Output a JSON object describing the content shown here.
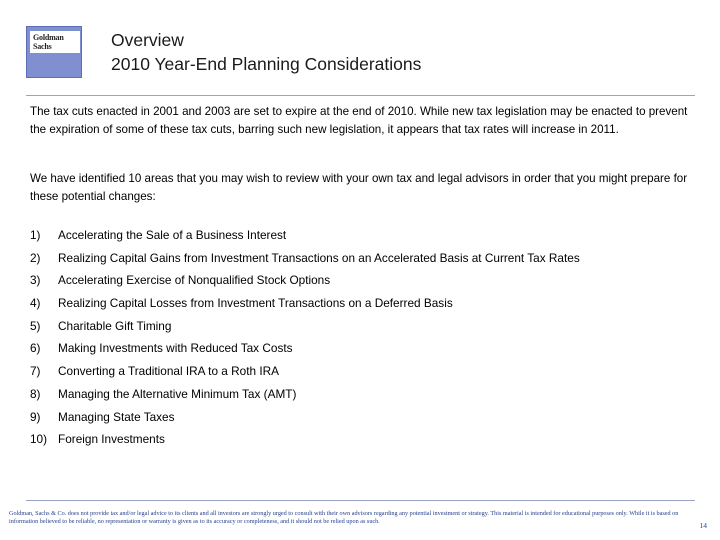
{
  "header": {
    "logo": {
      "line1": "Goldman",
      "line2": "Sachs"
    },
    "title_line1": "Overview",
    "title_line2": "2010 Year-End Planning Considerations"
  },
  "body": {
    "paragraph_1": "The tax cuts enacted in 2001 and 2003 are set to expire at the end of 2010.  While new tax legislation may be enacted to prevent the expiration of some of these tax cuts, barring such new legislation, it appears that tax rates will increase in 2011.",
    "paragraph_2": "We have identified 10 areas that you may wish to review with your own tax and legal advisors in order that you might prepare for these potential changes:",
    "items": [
      {
        "num": "1)",
        "text": "Accelerating the Sale of a Business Interest"
      },
      {
        "num": "2)",
        "text": "Realizing Capital Gains from Investment Transactions on an Accelerated Basis at Current Tax Rates"
      },
      {
        "num": "3)",
        "text": "Accelerating Exercise of Nonqualified Stock Options"
      },
      {
        "num": "4)",
        "text": "Realizing Capital Losses from Investment Transactions on a Deferred Basis"
      },
      {
        "num": "5)",
        "text": "Charitable Gift Timing"
      },
      {
        "num": "6)",
        "text": "Making Investments with Reduced Tax Costs"
      },
      {
        "num": "7)",
        "text": "Converting a Traditional IRA to a Roth IRA"
      },
      {
        "num": "8)",
        "text": "Managing the Alternative Minimum Tax (AMT)"
      },
      {
        "num": "9)",
        "text": "Managing State Taxes"
      },
      {
        "num": "10)",
        "text": "Foreign Investments"
      }
    ]
  },
  "footer": {
    "disclaimer": "Goldman, Sachs & Co. does not provide tax and/or legal advice to its clients and all investors are strongly urged to consult with their own advisors regarding any potential investment or strategy.  This material is intended for educational purposes only.  While it is based on information believed to be reliable, no representation or warranty is given as to its accuracy or completeness, and it should not be relied upon as such.",
    "page_number": "14"
  },
  "colors": {
    "accent": "#7f8fd0",
    "rule": "#9aa3c6",
    "footer_text": "#27408b"
  }
}
